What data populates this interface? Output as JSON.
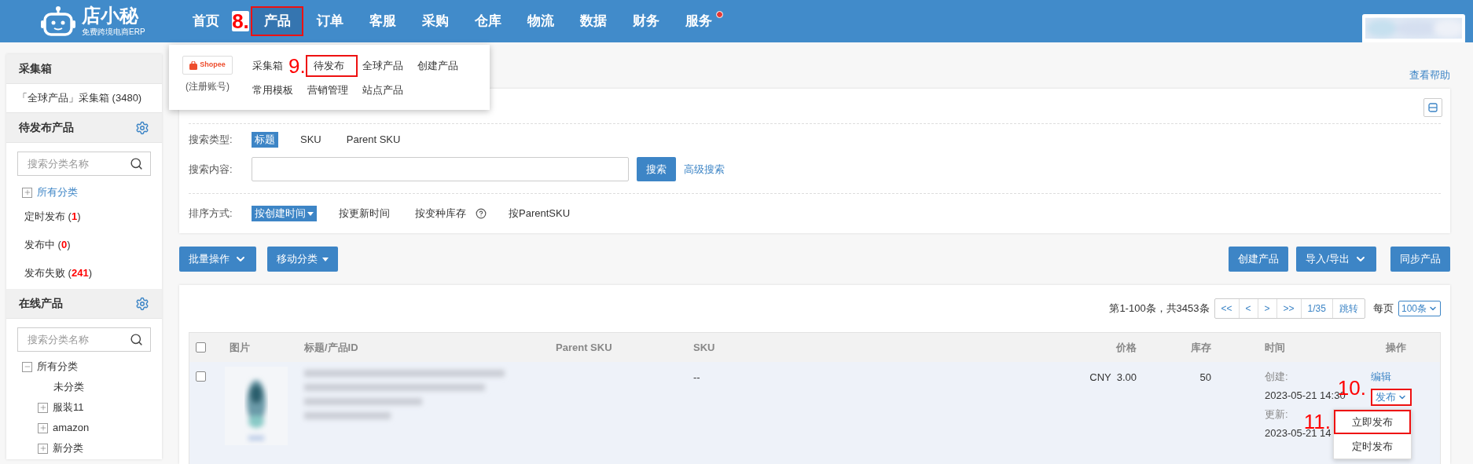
{
  "logo": {
    "name": "店小秘",
    "tagline": "免费跨境电商ERP"
  },
  "nav": [
    {
      "label": "首页",
      "selected": false
    },
    {
      "label": "产品",
      "selected": true,
      "step": "8."
    },
    {
      "label": "订单",
      "selected": false
    },
    {
      "label": "客服",
      "selected": false
    },
    {
      "label": "采购",
      "selected": false
    },
    {
      "label": "仓库",
      "selected": false
    },
    {
      "label": "物流",
      "selected": false
    },
    {
      "label": "数据",
      "selected": false
    },
    {
      "label": "财务",
      "selected": false
    },
    {
      "label": "服务",
      "selected": false,
      "badge": true
    }
  ],
  "nav_menu": {
    "platform": {
      "logo": "Shopee",
      "caption": "(注册账号)"
    },
    "rows": [
      [
        {
          "label": "采集箱"
        },
        {
          "label": "待发布",
          "step": "9."
        },
        {
          "label": "全球产品"
        },
        {
          "label": "创建产品"
        }
      ],
      [
        {
          "label": "常用模板"
        },
        {
          "label": "营销管理"
        },
        {
          "label": "站点产品"
        }
      ]
    ]
  },
  "help_link": "查看帮助",
  "sidebar": {
    "collect": {
      "title": "采集箱",
      "item": "「全球产品」采集箱 (3480)"
    },
    "pending": {
      "title": "待发布产品",
      "search_placeholder": "搜索分类名称",
      "tree": [
        {
          "label": "所有分类",
          "expanded": false,
          "selected": true
        }
      ],
      "statuses": [
        "定时发布 (**1**)",
        "发布中 (**0**)",
        "发布失败 (**241**)"
      ]
    },
    "online": {
      "title": "在线产品",
      "search_placeholder": "搜索分类名称",
      "tree": [
        {
          "label": "所有分类",
          "expanded": true,
          "selected": false,
          "children": [
            {
              "label": "未分类",
              "selected": false
            },
            {
              "label": "服装11",
              "expanded": false,
              "selected": false
            },
            {
              "label": "amazon",
              "expanded": false,
              "selected": false
            },
            {
              "label": "新分类",
              "expanded": false,
              "selected": false
            }
          ]
        }
      ]
    }
  },
  "filters": {
    "search_type": {
      "label": "搜索类型:",
      "options": [
        {
          "label": "标题",
          "selected": true
        },
        {
          "label": "SKU",
          "selected": false
        },
        {
          "label": "Parent SKU",
          "selected": false
        }
      ]
    },
    "search_content": {
      "label": "搜索内容:",
      "button": "搜索",
      "advanced": "高级搜索"
    },
    "sort": {
      "label": "排序方式:",
      "options": [
        {
          "label": "按创建时间",
          "selected": true
        },
        {
          "label": "按更新时间",
          "selected": false
        },
        {
          "label": "按变种库存",
          "selected": false,
          "help": true
        },
        {
          "label": "按ParentSKU",
          "selected": false
        }
      ]
    }
  },
  "toolbar": {
    "left": [
      {
        "label": "批量操作",
        "kind": "chevron"
      },
      {
        "label": "移动分类",
        "kind": "triangle"
      }
    ],
    "right": [
      {
        "label": "创建产品",
        "kind": "plain"
      },
      {
        "label": "导入/导出",
        "kind": "chevron"
      },
      {
        "label": "同步产品",
        "kind": "plain"
      }
    ]
  },
  "pagination": {
    "summary": "第1-100条，共3453条",
    "buttons": [
      "<<",
      "<",
      ">",
      ">>",
      "1/35",
      "跳转"
    ],
    "per_page_label": "每页",
    "per_page": "100条"
  },
  "table": {
    "header_checked": false,
    "columns": [
      "图片",
      "标题/产品ID",
      "Parent SKU",
      "SKU",
      "价格",
      "库存",
      "时间",
      "操作"
    ],
    "rows": [
      {
        "checked": false,
        "sku": "--",
        "price": "CNY  3.00",
        "stock": "50",
        "created_label": "创建:",
        "created": "2023-05-21 14:30",
        "updated_label": "更新:",
        "updated": "2023-05-21 14",
        "actions": {
          "edit": "编辑",
          "publish": {
            "label": "发布",
            "step": "10.",
            "expanded": true,
            "menu": [
              {
                "label": "立即发布",
                "step": "11."
              },
              {
                "label": "定时发布"
              }
            ]
          }
        }
      }
    ]
  }
}
